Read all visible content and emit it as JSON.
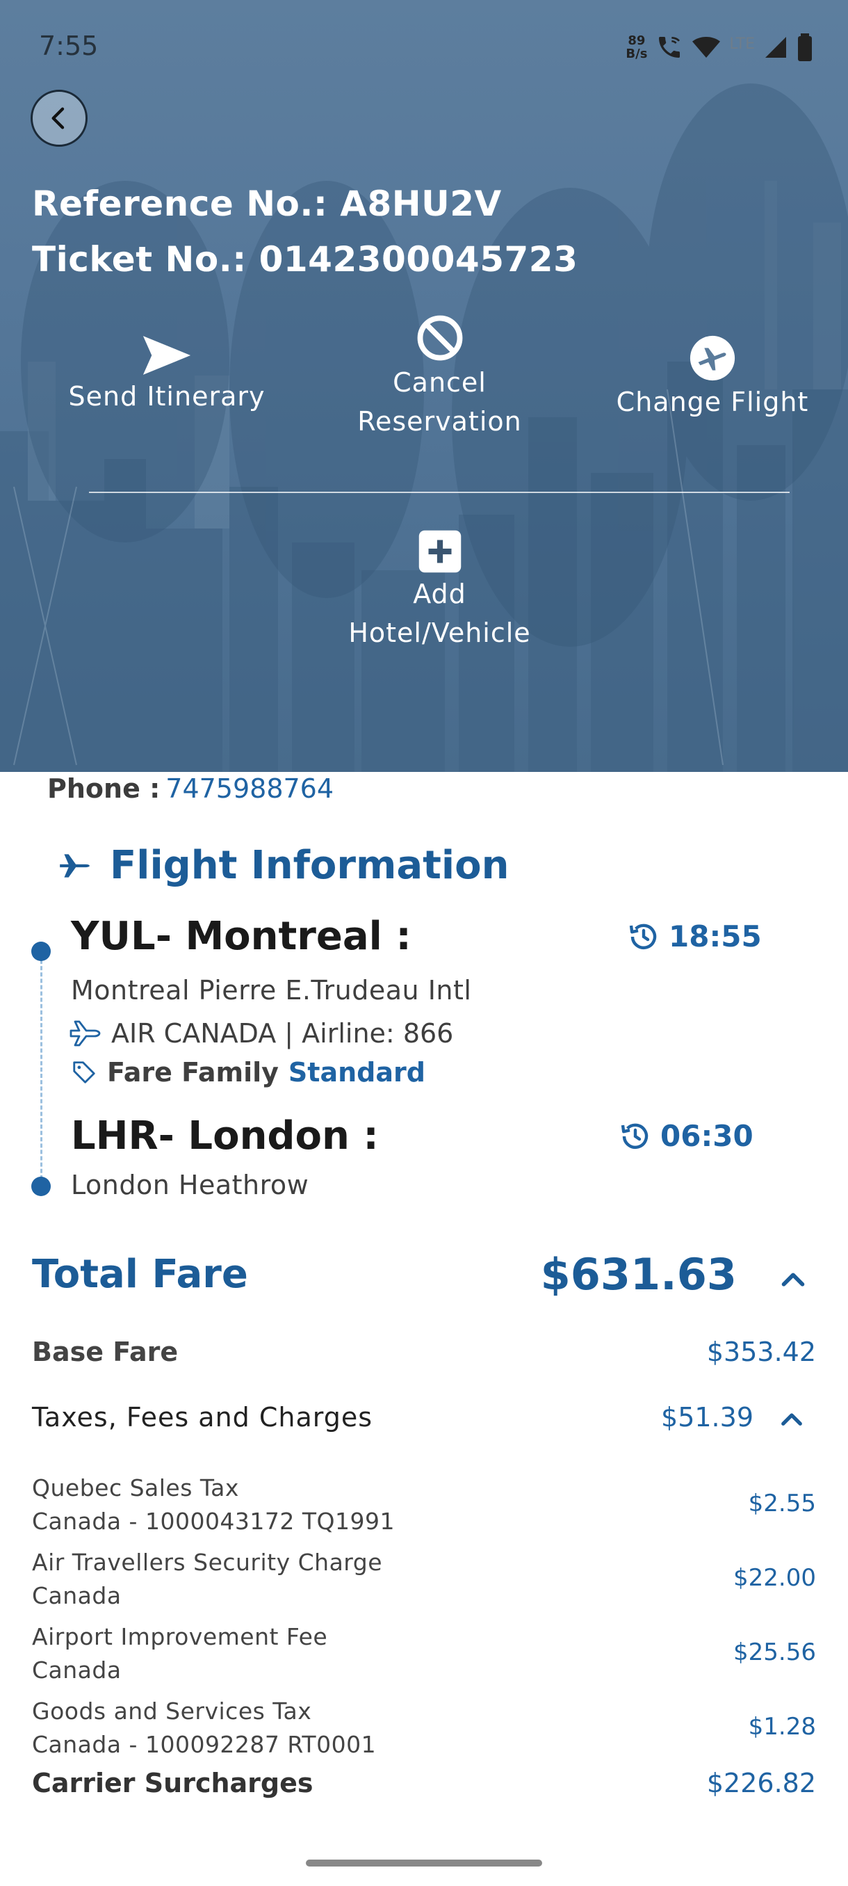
{
  "status_bar": {
    "time": "7:55",
    "speed_value": "89",
    "speed_unit": "B/s",
    "network_label": "LTE"
  },
  "header": {
    "reference_label": "Reference No.: A8HU2V",
    "ticket_label": "Ticket No.: 0142300045723"
  },
  "actions": {
    "send_itinerary": "Send Itinerary",
    "cancel_line1": "Cancel",
    "cancel_line2": "Reservation",
    "change_flight": "Change Flight",
    "add_line1": "Add",
    "add_line2": "Hotel/Vehicle"
  },
  "contact": {
    "phone_label": "Phone :",
    "phone_value": "7475988764"
  },
  "flight_info": {
    "title": "Flight Information",
    "departure": {
      "city": "YUL- Montreal :",
      "time": "18:55",
      "airport": "Montreal Pierre E.Trudeau Intl",
      "airline": "AIR CANADA | Airline: 866",
      "fare_family_label": "Fare Family",
      "fare_family_value": "Standard"
    },
    "arrival": {
      "city": "LHR- London :",
      "time": "06:30",
      "airport": "London Heathrow"
    }
  },
  "fare": {
    "total_label": "Total Fare",
    "total_value": "$631.63",
    "base_label": "Base Fare",
    "base_value": "$353.42",
    "taxes_label": "Taxes, Fees and Charges",
    "taxes_value": "$51.39",
    "tax_items": [
      {
        "line1": "Quebec Sales Tax",
        "line2": "Canada - 1000043172 TQ1991",
        "value": "$2.55"
      },
      {
        "line1": "Air Travellers Security Charge",
        "line2": "Canada",
        "value": "$22.00"
      },
      {
        "line1": "Airport Improvement Fee",
        "line2": "Canada",
        "value": "$25.56"
      },
      {
        "line1": "Goods and Services Tax",
        "line2": "Canada - 100092287 RT0001",
        "value": "$1.28"
      }
    ],
    "surcharge_label": "Carrier Surcharges",
    "surcharge_value": "$226.82"
  },
  "colors": {
    "brand_blue": "#1c5c97",
    "link_blue": "#1f63a3",
    "hero_overlay": "#56789a"
  }
}
